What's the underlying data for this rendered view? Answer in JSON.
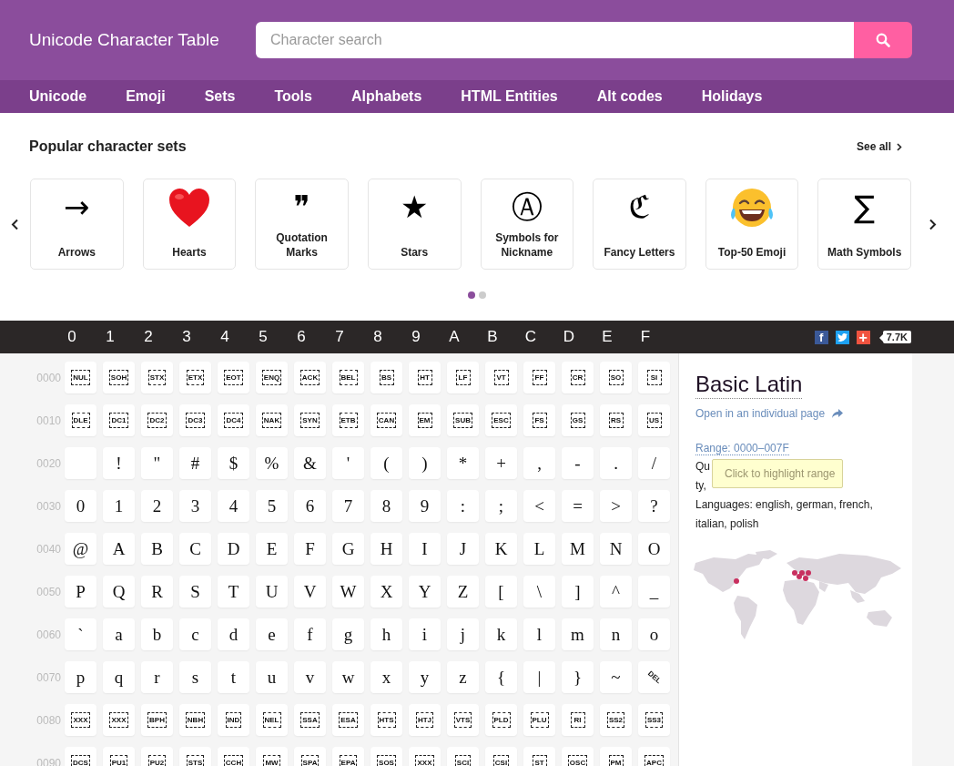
{
  "header": {
    "title": "Unicode Character Table",
    "search": {
      "placeholder": "Character search"
    }
  },
  "nav": [
    "Unicode",
    "Emoji",
    "Sets",
    "Tools",
    "Alphabets",
    "HTML Entities",
    "Alt codes",
    "Holidays"
  ],
  "popular": {
    "title": "Popular character sets",
    "see_all": "See all",
    "cards": [
      {
        "kind": "glyph",
        "symbol": "→",
        "label": "Arrows"
      },
      {
        "kind": "heart",
        "label": "Hearts"
      },
      {
        "kind": "glyph",
        "symbol": "❞",
        "label": "Quotation Marks"
      },
      {
        "kind": "glyph",
        "symbol": "★",
        "label": "Stars"
      },
      {
        "kind": "glyph",
        "symbol": "Ⓐ",
        "label": "Symbols for Nickname"
      },
      {
        "kind": "glyph",
        "symbol": "ℭ",
        "label": "Fancy Letters"
      },
      {
        "kind": "emoji",
        "label": "Top-50 Emoji"
      },
      {
        "kind": "glyph",
        "symbol": "∑",
        "label": "Math Symbols"
      }
    ],
    "pages": [
      {
        "selected": true
      },
      {
        "selected": false
      }
    ]
  },
  "hex_header": [
    "0",
    "1",
    "2",
    "3",
    "4",
    "5",
    "6",
    "7",
    "8",
    "9",
    "A",
    "B",
    "C",
    "D",
    "E",
    "F"
  ],
  "share": {
    "buttons": [
      {
        "kind": "facebook",
        "glyph": "f"
      },
      {
        "kind": "twitter"
      },
      {
        "kind": "plus",
        "glyph": "+"
      }
    ],
    "count": "7.7K"
  },
  "grid": [
    {
      "code": "0000",
      "kind": "control",
      "cells": [
        "NUL",
        "SOH",
        "STX",
        "ETX",
        "EOT",
        "ENQ",
        "ACK",
        "BEL",
        "BS",
        "HT",
        "LF",
        "VT",
        "FF",
        "CR",
        "SO",
        "SI"
      ]
    },
    {
      "code": "0010",
      "kind": "control",
      "cells": [
        "DLE",
        "DC1",
        "DC2",
        "DC3",
        "DC4",
        "NAK",
        "SYN",
        "ETB",
        "CAN",
        "EM",
        "SUB",
        "ESC",
        "FS",
        "GS",
        "RS",
        "US"
      ]
    },
    {
      "code": "0020",
      "kind": "glyph",
      "cells": [
        {
          "kind": "blank"
        },
        "!",
        "\"",
        "#",
        "$",
        "%",
        "&",
        "'",
        "(",
        ")",
        "*",
        "+",
        ",",
        "-",
        ".",
        "/"
      ]
    },
    {
      "code": "0030",
      "kind": "glyph",
      "cells": [
        "0",
        "1",
        "2",
        "3",
        "4",
        "5",
        "6",
        "7",
        "8",
        "9",
        ":",
        ";",
        "<",
        "=",
        ">",
        "?"
      ]
    },
    {
      "code": "0040",
      "kind": "glyph",
      "cells": [
        "@",
        "A",
        "B",
        "C",
        "D",
        "E",
        "F",
        "G",
        "H",
        "I",
        "J",
        "K",
        "L",
        "M",
        "N",
        "O"
      ]
    },
    {
      "code": "0050",
      "kind": "glyph",
      "cells": [
        "P",
        "Q",
        "R",
        "S",
        "T",
        "U",
        "V",
        "W",
        "X",
        "Y",
        "Z",
        "[",
        "\\",
        "]",
        "^",
        "_"
      ]
    },
    {
      "code": "0060",
      "kind": "glyph",
      "cells": [
        "`",
        "a",
        "b",
        "c",
        "d",
        "e",
        "f",
        "g",
        "h",
        "i",
        "j",
        "k",
        "l",
        "m",
        "n",
        "o"
      ]
    },
    {
      "code": "0070",
      "kind": "glyph",
      "cells": [
        "p",
        "q",
        "r",
        "s",
        "t",
        "u",
        "v",
        "w",
        "x",
        "y",
        "z",
        "{",
        "|",
        "}",
        "~",
        {
          "kind": "del",
          "text": "DEL"
        }
      ]
    },
    {
      "code": "0080",
      "kind": "control",
      "cells": [
        "XXX",
        "XXX",
        "BPH",
        "NBH",
        "IND",
        "NEL",
        "SSA",
        "ESA",
        "HTS",
        "HTJ",
        "VTS",
        "PLD",
        "PLU",
        "RI",
        "SS2",
        "SS3"
      ]
    },
    {
      "code": "0090",
      "kind": "control",
      "cells": [
        "DCS",
        "PU1",
        "PU2",
        "STS",
        "CCH",
        "MW",
        "SPA",
        "EPA",
        "SOS",
        "XXX",
        "SCI",
        "CSI",
        "ST",
        "OSC",
        "PM",
        "APC"
      ]
    }
  ],
  "block": {
    "title": "Basic Latin",
    "open_link": "Open in an individual page",
    "range": "Range: 0000–007F",
    "tooltip": "Click to highlight range",
    "lines": [
      "Qu",
      "ty,",
      "Languages: english, german, french, italian, polish"
    ]
  }
}
